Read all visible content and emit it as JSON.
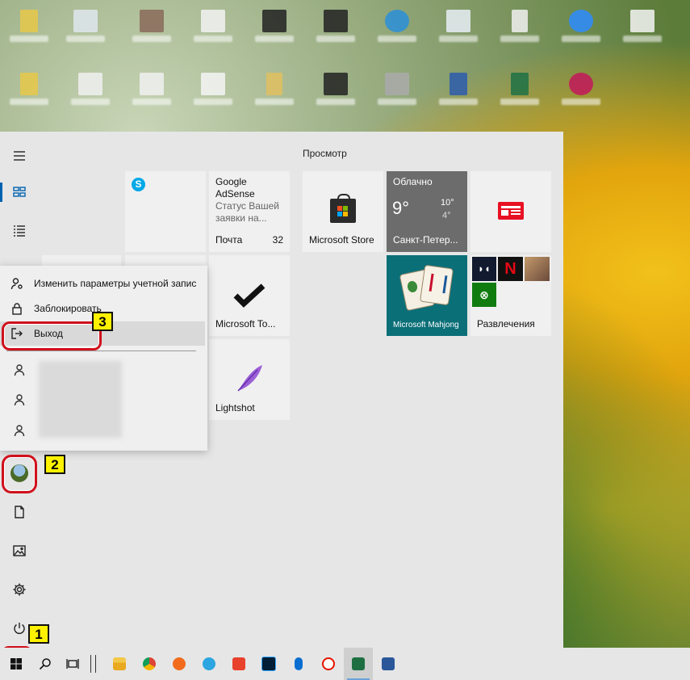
{
  "start_menu": {
    "section_title": "Просмотр",
    "tiles": {
      "skype": {
        "name": ""
      },
      "google_adsense": {
        "line1": "Google",
        "line2": "AdSense",
        "line3": "Статус Вашей",
        "line4": "заявки на...",
        "app": "Почта",
        "count": "32"
      },
      "microsoft_store": {
        "name": "Microsoft Store"
      },
      "weather": {
        "condition": "Облачно",
        "temp": "9°",
        "high": "10°",
        "low": "4°",
        "city": "Санкт-Петер..."
      },
      "news": {
        "name": ""
      },
      "microsoft_todo": {
        "name": "Microsoft To..."
      },
      "mahjong": {
        "name": "Microsoft Mahjong"
      },
      "entertainment": {
        "name": "Развлечения"
      },
      "lightshot": {
        "name": "Lightshot"
      }
    }
  },
  "account_flyout": {
    "change_settings": "Изменить параметры учетной запис",
    "lock": "Заблокировать",
    "sign_out": "Выход"
  },
  "callouts": {
    "one": "1",
    "two": "2",
    "three": "3"
  },
  "colors": {
    "accent": "#0063b1",
    "highlight": "#fff200",
    "ring": "#d0101c"
  }
}
